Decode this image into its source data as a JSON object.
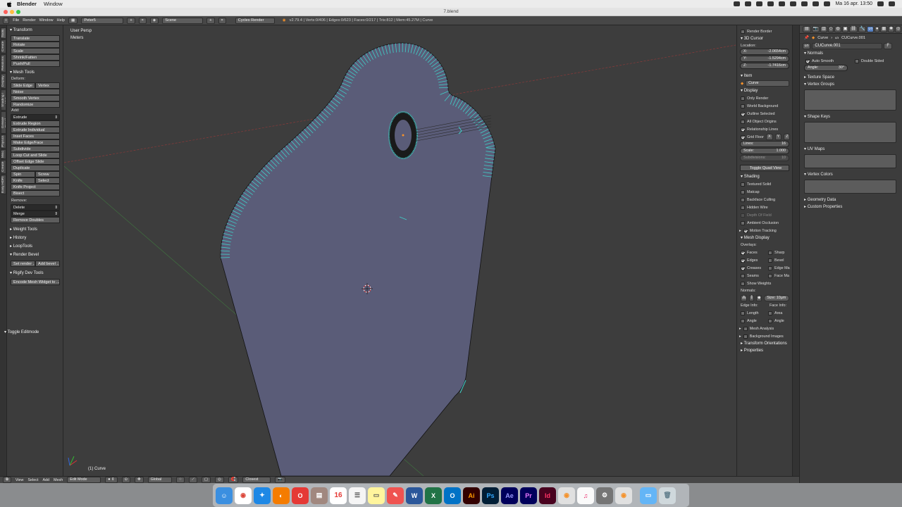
{
  "mac_menubar": {
    "app_name": "Blender",
    "menu": [
      "Window"
    ],
    "date_time": "Ma 16 apr.  13:50"
  },
  "window": {
    "title": "7.blend"
  },
  "info_header": {
    "menus": [
      "File",
      "Render",
      "Window",
      "Help"
    ],
    "screen_layout": "Peter5",
    "scene": "Scene",
    "render_engine": "Cycles Render",
    "stats": "v2.79.4 | Verts:0/406 | Edges:0/623 | Faces:0/217 | Tris:812 | Mem:45.27M | Curve"
  },
  "vertical_tabs": [
    "Tools",
    "Create",
    "Relations",
    "Display",
    "Shading / UVs",
    "Grease Pencil",
    "Physics",
    "Misc",
    "Create",
    "Easy HDRI"
  ],
  "tool_shelf": {
    "transform": {
      "title": "Transform",
      "buttons": [
        "Translate",
        "Rotate",
        "Scale",
        "Shrink/Fatten",
        "Push/Pull"
      ]
    },
    "mesh_tools": {
      "title": "Mesh Tools",
      "deform_label": "Deform:",
      "slide_edge": "Slide Edge",
      "vertex": "Vertex",
      "deform_buttons": [
        "Noise",
        "Smooth Vertex",
        "Randomize"
      ],
      "add_label": "Add:",
      "extrude": "Extrude",
      "add_buttons": [
        "Extrude Region",
        "Extrude Individual",
        "Inset Faces",
        "Make Edge/Face",
        "Subdivide",
        "Loop Cut and Slide",
        "Offset Edge Slide",
        "Duplicate"
      ],
      "spin": "Spin",
      "screw": "Screw",
      "knife": "Knife",
      "select": "Select",
      "knife_project": "Knife Project",
      "bisect": "Bisect",
      "remove_label": "Remove:",
      "delete": "Delete",
      "merge": "Merge",
      "remove_doubles": "Remove Doubles"
    },
    "collapsed": [
      "Weight Tools",
      "History",
      "LoopTools"
    ],
    "render_bevel": {
      "title": "Render Bevel",
      "set": "Set render ...",
      "add": "Add bevel ..."
    },
    "rigify": {
      "title": "Rigify Dev Tools",
      "button": "Encode Mesh Widget to ..."
    },
    "toggle_editmode": "Toggle Editmode"
  },
  "viewport": {
    "view_name": "User Persp",
    "units": "Meters",
    "object_label": "(1) Curve"
  },
  "n_panel": {
    "render_border": "Render Border",
    "cursor": {
      "title": "3D Cursor",
      "location_label": "Location:",
      "x": "-2.0654cm",
      "y": "-1.5294cm",
      "z": "-1.7416cm"
    },
    "item": {
      "title": "Item",
      "name": "Curve"
    },
    "display": {
      "title": "Display",
      "only_render": "Only Render",
      "world_background": "World Background",
      "outline_selected": "Outline Selected",
      "all_object_origins": "All Object Origins",
      "relationship_lines": "Relationship Lines",
      "grid_floor": "Grid Floor",
      "axes": [
        "X",
        "Y",
        "Z"
      ],
      "lines_label": "Lines:",
      "lines": "16",
      "scale_label": "Scale:",
      "scale": "1.000",
      "subdiv_label": "Subdivisions:",
      "subdiv": "10",
      "toggle_quad": "Toggle Quad View"
    },
    "shading": {
      "title": "Shading",
      "items": [
        "Textured Solid",
        "Matcap",
        "Backface Culling",
        "Hidden Wire",
        "Depth Of Field",
        "Ambient Occlusion"
      ]
    },
    "motion_tracking": "Motion Tracking",
    "mesh_display": {
      "title": "Mesh Display",
      "overlays_label": "Overlays:",
      "left": [
        "Faces",
        "Edges",
        "Creases",
        "Seams"
      ],
      "right": [
        "Sharp",
        "Bevel",
        "Edge Ma",
        "Face Ma"
      ],
      "show_weights": "Show Weights",
      "normals_label": "Normals:",
      "size": "Size: 10µm",
      "edge_info": "Edge Info:",
      "face_info": "Face Info:",
      "length": "Length",
      "area": "Area",
      "angle_e": "Angle",
      "angle_f": "Angle"
    },
    "collapsed": [
      "Mesh Analysis",
      "Background Images",
      "Transform Orientations",
      "Properties"
    ]
  },
  "properties": {
    "breadcrumb": [
      "Curve",
      "CUCurve.001"
    ],
    "data_name": "CUCurve.001",
    "fake_user": "F",
    "normals": {
      "title": "Normals",
      "auto_smooth": "Auto Smooth",
      "double_sided": "Double Sided",
      "angle_label": "Angle:",
      "angle": "30°"
    },
    "sections": [
      "Texture Space",
      "Vertex Groups",
      "Shape Keys",
      "UV Maps",
      "Vertex Colors",
      "Geometry Data",
      "Custom Properties"
    ]
  },
  "bottom_header": {
    "menus": [
      "View",
      "Select",
      "Add",
      "Mesh"
    ],
    "mode": "Edit Mode",
    "orientation": "Global",
    "snap": "Closest"
  },
  "dock": {
    "items": [
      "finder",
      "chrome",
      "safari",
      "firefox",
      "opera",
      "archive",
      "calendar",
      "reminders",
      "notes",
      "pdf",
      "word",
      "excel",
      "outlook",
      "illustrator",
      "photoshop",
      "after-effects",
      "premiere",
      "indesign",
      "blender",
      "itunes",
      "system-prefs",
      "blender-2",
      "folder",
      "trash"
    ],
    "calendar_day": "16",
    "labels": {
      "illustrator": "Ai",
      "photoshop": "Ps",
      "after-effects": "Ae",
      "premiere": "Pr",
      "indesign": "Id",
      "word": "W",
      "excel": "X",
      "outlook": "O"
    }
  }
}
